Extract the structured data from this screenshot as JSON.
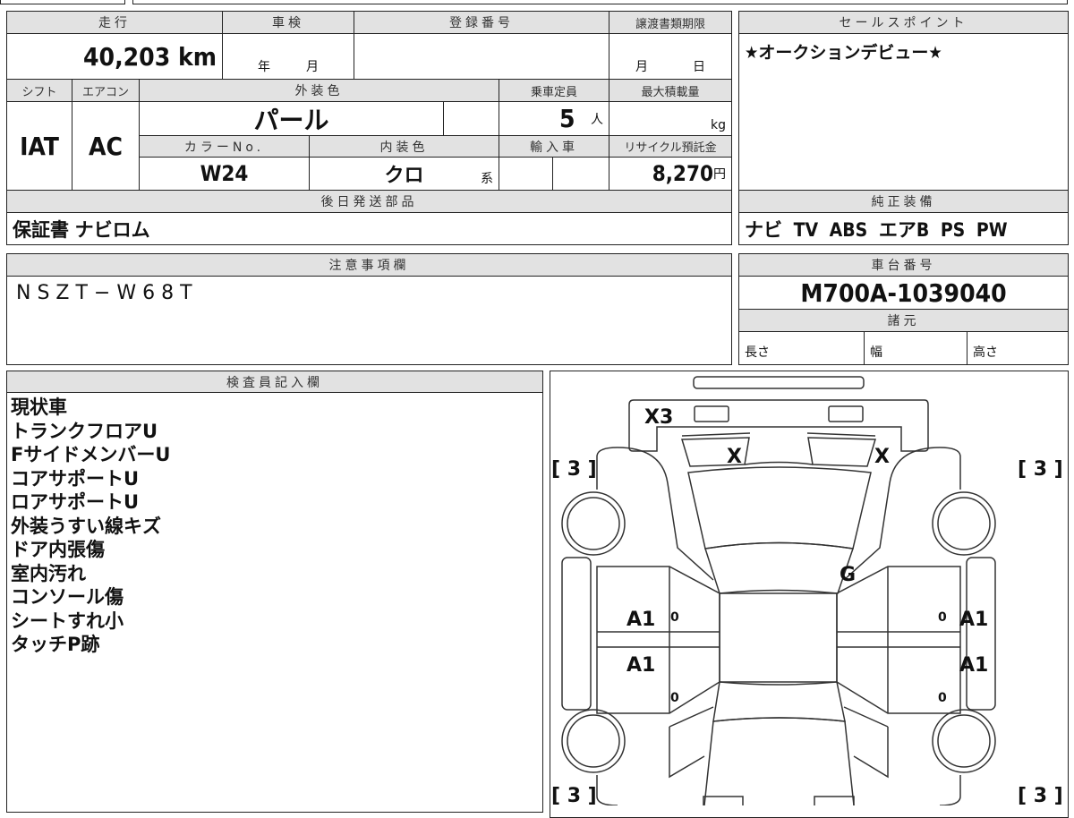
{
  "mileage": {
    "label": "走行",
    "value": "40,203",
    "unit": "km"
  },
  "shaken": {
    "label": "車検",
    "year": "年",
    "month": "月"
  },
  "registration": {
    "label": "登録番号"
  },
  "transfer_deadline": {
    "label": "譲渡書類期限",
    "month": "月",
    "day": "日"
  },
  "shift": {
    "label": "シフト",
    "value": "IAT"
  },
  "aircon": {
    "label": "エアコン",
    "value": "AC"
  },
  "exterior_color": {
    "label": "外装色",
    "value": "パール"
  },
  "capacity": {
    "label": "乗車定員",
    "value": "5",
    "unit": "人"
  },
  "max_load": {
    "label": "最大積載量",
    "unit": "kg"
  },
  "color_no": {
    "label": "カラーNo.",
    "value": "W24"
  },
  "interior_color": {
    "label": "内装色",
    "value": "クロ",
    "suffix": "系"
  },
  "import": {
    "label": "輸入車"
  },
  "recycle": {
    "label": "リサイクル預託金",
    "value": "8,270",
    "unit": "円"
  },
  "later_parts": {
    "label": "後日発送部品",
    "value": "保証書 ナビロム"
  },
  "sales_point": {
    "label": "セールスポイント",
    "value": "★オークションデビュー★"
  },
  "equipment": {
    "label": "純正装備",
    "value": "ナビ TV ABS エアB PS PW"
  },
  "caution": {
    "label": "注意事項欄",
    "value": "NSZT−W68T"
  },
  "chassis": {
    "label": "車台番号",
    "value": "M700A-1039040"
  },
  "specs": {
    "label": "諸元",
    "length": "長さ",
    "width": "幅",
    "height": "高さ"
  },
  "inspector": {
    "label": "検査員記入欄",
    "lines": [
      "現状車",
      "トランクフロアU",
      "FサイドメンバーU",
      "コアサポートU",
      "ロアサポートU",
      "外装うすい線キズ",
      "ドア内張傷",
      "室内汚れ",
      "コンソール傷",
      "シートすれ小",
      "タッチP跡"
    ]
  },
  "diagram": {
    "marks": {
      "front_bumper": "X3",
      "headlight_left": "X",
      "headlight_right": "X",
      "roof": "G",
      "door_fl": "A1",
      "door_rl": "A1",
      "door_fr": "A1",
      "door_rr": "A1",
      "tire_fl": "[ 3 ]",
      "tire_fr": "[ 3 ]",
      "tire_rl": "[ 3 ]",
      "tire_rr": "[ 3 ]",
      "small": "0"
    }
  }
}
